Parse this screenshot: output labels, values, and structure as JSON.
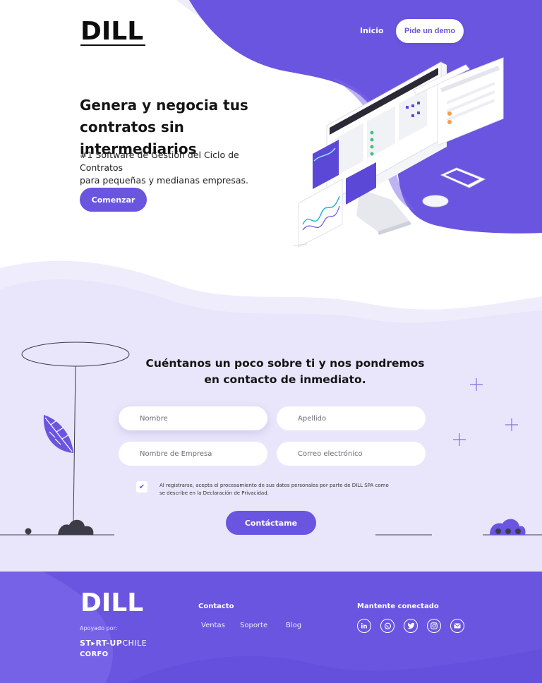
{
  "brand": {
    "logo": "DILL"
  },
  "nav": {
    "home": "Inicio",
    "demo": "Pide un demo"
  },
  "hero": {
    "title_line1": "Genera y negocia tus",
    "title_line2": "contratos sin intermediarios",
    "subtitle_line1": "#1 Software de Gestión del Ciclo de Contratos",
    "subtitle_line2": "para pequeñas y medianas empresas.",
    "cta": "Comenzar"
  },
  "form": {
    "title_line1": "Cuéntanos un poco sobre ti y nos pondremos",
    "title_line2": "en contacto de inmediato.",
    "fields": {
      "first_name": "Nombre",
      "last_name": "Apellido",
      "company": "Nombre de Empresa",
      "email": "Correo electrónico"
    },
    "consent_line1": "Al registrarse, acepta el procesamiento de sus datos personales por parte de DILL SPA como",
    "consent_line2": "se describe en la Declaración de Privacidad.",
    "consent_checked": true,
    "submit": "Contáctame"
  },
  "footer": {
    "logo": "DILL",
    "supported_by": "Apoyado por:",
    "sponsor1_bold": "ST▸RT-UP",
    "sponsor1_light": "CHILE",
    "sponsor2": "CORFO",
    "contact_heading": "Contacto",
    "links": [
      "Ventas",
      "Soporte",
      "Blog"
    ],
    "social_heading": "Mantente conectado",
    "social_icons": [
      "linkedin-icon",
      "whatsapp-icon",
      "twitter-icon",
      "instagram-icon",
      "email-icon"
    ]
  },
  "colors": {
    "accent": "#6a55e0",
    "accent_light": "#e9e6fb",
    "accent_lighter": "#f2f0fd",
    "text": "#141414",
    "white": "#ffffff"
  }
}
